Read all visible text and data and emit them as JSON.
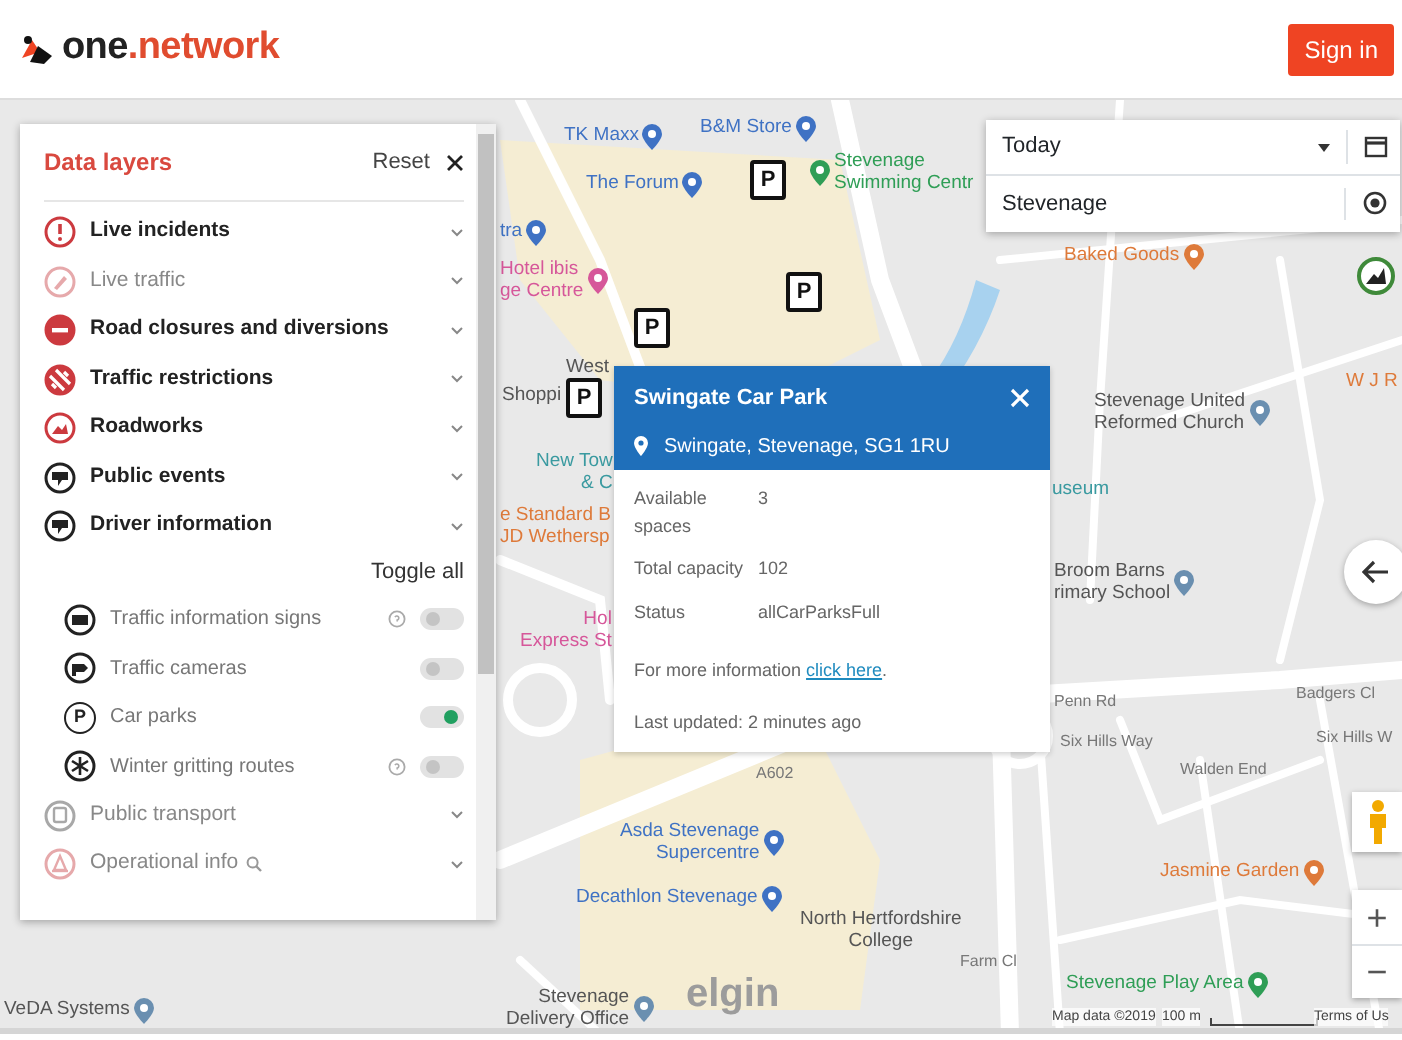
{
  "header": {
    "logo": [
      "one",
      ".network"
    ],
    "sign_in": "Sign in"
  },
  "panel": {
    "title": "Data layers",
    "reset": "Reset",
    "layers": [
      {
        "kind": "group",
        "label": "Live incidents",
        "active": true,
        "color": "#cc3a3f"
      },
      {
        "kind": "group",
        "label": "Live traffic",
        "active": false,
        "color": "#e6a9ab"
      },
      {
        "kind": "group",
        "label": "Road closures and diversions",
        "active": true,
        "color": "#cc3a3f"
      },
      {
        "kind": "group",
        "label": "Traffic restrictions",
        "active": true,
        "color": "#cc3a3f"
      },
      {
        "kind": "group",
        "label": "Roadworks",
        "active": true,
        "color": "#cc3a3f"
      },
      {
        "kind": "group",
        "label": "Public events",
        "active": true,
        "color": "#222222"
      },
      {
        "kind": "group",
        "label": "Driver information",
        "active": true,
        "color": "#222222"
      },
      {
        "kind": "toggleall",
        "label": "Toggle all"
      },
      {
        "kind": "sublayer",
        "label": "Traffic information signs",
        "on": false,
        "help": true
      },
      {
        "kind": "sublayer",
        "label": "Traffic cameras",
        "on": false,
        "help": false
      },
      {
        "kind": "sublayer",
        "label": "Car parks",
        "on": true,
        "help": false,
        "glyph": "P"
      },
      {
        "kind": "sublayer",
        "label": "Winter gritting routes",
        "on": false,
        "help": true
      },
      {
        "kind": "group",
        "label": "Public transport",
        "active": false,
        "color": "#a8a8a8"
      },
      {
        "kind": "group",
        "label": "Operational info",
        "active": false,
        "color": "#e6a9ab",
        "search": true
      }
    ]
  },
  "filters": {
    "date": "Today",
    "location": "Stevenage"
  },
  "popup": {
    "title": "Swingate Car Park",
    "address": "Swingate, Stevenage, SG1 1RU",
    "fields": [
      {
        "label": "Available spaces",
        "value": "3"
      },
      {
        "label": "Total capacity",
        "value": "102"
      },
      {
        "label": "Status",
        "value": "allCarParksFull"
      }
    ],
    "more_text": "For more information ",
    "more_link": "click here",
    "more_end": ".",
    "updated": "Last updated: 2 minutes ago"
  },
  "markers": [
    {
      "glyph": "P"
    },
    {
      "glyph": "P"
    },
    {
      "glyph": "P"
    },
    {
      "glyph": "P"
    }
  ],
  "map_labels": [
    {
      "lines": [
        "TK Maxx"
      ],
      "kind": "shop",
      "pin": true
    },
    {
      "lines": [
        "B&M Store"
      ],
      "kind": "shop",
      "pin": true
    },
    {
      "lines": [
        "The Forum"
      ],
      "kind": "shop",
      "pin": true
    },
    {
      "lines": [
        "Stevenage",
        "Swimming Centr"
      ],
      "kind": "leisure",
      "pin": true
    },
    {
      "lines": [
        "tra"
      ],
      "kind": "shop",
      "pin": true
    },
    {
      "lines": [
        "Hotel ibis",
        "ge Centre"
      ],
      "kind": "hotel",
      "pin": true
    },
    {
      "lines": [
        "West"
      ],
      "kind": "place"
    },
    {
      "lines": [
        "Shoppi"
      ],
      "kind": "place"
    },
    {
      "lines": [
        "New Tow",
        "& C"
      ],
      "kind": "museum"
    },
    {
      "lines": [
        "e Standard B",
        "JD Wethersp"
      ],
      "kind": "food"
    },
    {
      "lines": [
        "Hol",
        "Express St"
      ],
      "kind": "hotel"
    },
    {
      "lines": [
        "Baked Goods"
      ],
      "kind": "food",
      "pin": true
    },
    {
      "lines": [
        "Stevenage United",
        "Reformed Church"
      ],
      "kind": "place",
      "pin": true
    },
    {
      "lines": [
        "W J R"
      ],
      "kind": "food"
    },
    {
      "lines": [
        "useum"
      ],
      "kind": "museum"
    },
    {
      "lines": [
        "Broom Barns",
        "rimary School"
      ],
      "kind": "place",
      "pin": true
    },
    {
      "lines": [
        "Penn Rd"
      ],
      "kind": "road"
    },
    {
      "lines": [
        "Badgers Cl"
      ],
      "kind": "road"
    },
    {
      "lines": [
        "Six Hills Way"
      ],
      "kind": "road"
    },
    {
      "lines": [
        "Six Hills W"
      ],
      "kind": "road"
    },
    {
      "lines": [
        "A602"
      ],
      "kind": "road"
    },
    {
      "lines": [
        "Asda Stevenage",
        "Supercentre"
      ],
      "kind": "shop",
      "pin": true
    },
    {
      "lines": [
        "Decathlon Stevenage"
      ],
      "kind": "shop",
      "pin": true
    },
    {
      "lines": [
        "North Hertfordshire",
        "College"
      ],
      "kind": "place"
    },
    {
      "lines": [
        "Jasmine Garden"
      ],
      "kind": "food",
      "pin": true
    },
    {
      "lines": [
        "Stevenage Play Area"
      ],
      "kind": "leisure",
      "pin": true
    },
    {
      "lines": [
        "VeDA Systems"
      ],
      "kind": "place",
      "pin": true
    },
    {
      "lines": [
        "Stevenage",
        "Delivery Office"
      ],
      "kind": "place",
      "pin": true
    },
    {
      "lines": [
        "Farm Cl"
      ],
      "kind": "road"
    },
    {
      "lines": [
        "Walden End"
      ],
      "kind": "road"
    },
    {
      "lines": [
        "elgin"
      ],
      "kind": "logo"
    }
  ],
  "zoom": [
    "+",
    "−"
  ],
  "attribution": [
    "Map data ©2019",
    "100 m",
    "Terms of Us"
  ]
}
